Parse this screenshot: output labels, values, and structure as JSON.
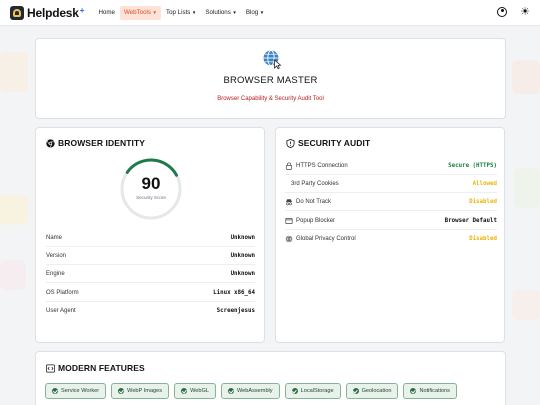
{
  "navbar": {
    "brand": "Helpdesk",
    "brand_plus": "+",
    "items": [
      {
        "label": "Home",
        "dropdown": false,
        "active": false
      },
      {
        "label": "WebTools",
        "dropdown": true,
        "active": true
      },
      {
        "label": "Top Lists",
        "dropdown": true,
        "active": false
      },
      {
        "label": "Solutions",
        "dropdown": true,
        "active": false
      },
      {
        "label": "Blog",
        "dropdown": true,
        "active": false
      }
    ]
  },
  "hero": {
    "title": "BROWSER MASTER",
    "subtitle": "Browser Capability & Security Audit Tool"
  },
  "identity": {
    "heading": "BROWSER IDENTITY",
    "score": "90",
    "score_fraction": 0.9,
    "score_label": "Security Score",
    "rows": [
      {
        "label": "Name",
        "value": "Unknown"
      },
      {
        "label": "Version",
        "value": "Unknown"
      },
      {
        "label": "Engine",
        "value": "Unknown"
      },
      {
        "label": "OS Platform",
        "value": "Linux x86_64"
      },
      {
        "label": "User Agent",
        "value": "Screenjesus"
      }
    ]
  },
  "security": {
    "heading": "SECURITY AUDIT",
    "rows": [
      {
        "label": "HTTPS Connection",
        "value": "Secure (HTTPS)",
        "status": "green",
        "icon": "lock-icon"
      },
      {
        "label": "3rd Party Cookies",
        "value": "Allowed",
        "status": "amber",
        "icon": "cookie-icon"
      },
      {
        "label": "Do Not Track",
        "value": "Disabled",
        "status": "amber",
        "icon": "incognito-icon"
      },
      {
        "label": "Popup Blocker",
        "value": "Browser Default",
        "status": "dark",
        "icon": "window-icon"
      },
      {
        "label": "Global Privacy Control",
        "value": "Disabled",
        "status": "amber",
        "icon": "globe-icon"
      }
    ]
  },
  "features": {
    "heading": "MODERN FEATURES",
    "badges": [
      "Service Worker",
      "WebP Images",
      "WebGL",
      "WebAssembly",
      "LocalStorage",
      "Geolocation",
      "Notifications"
    ]
  },
  "colors": {
    "accent": "#d9501f",
    "green": "#15803d",
    "amber": "#eab308",
    "gauge": "#1f7a4a"
  }
}
